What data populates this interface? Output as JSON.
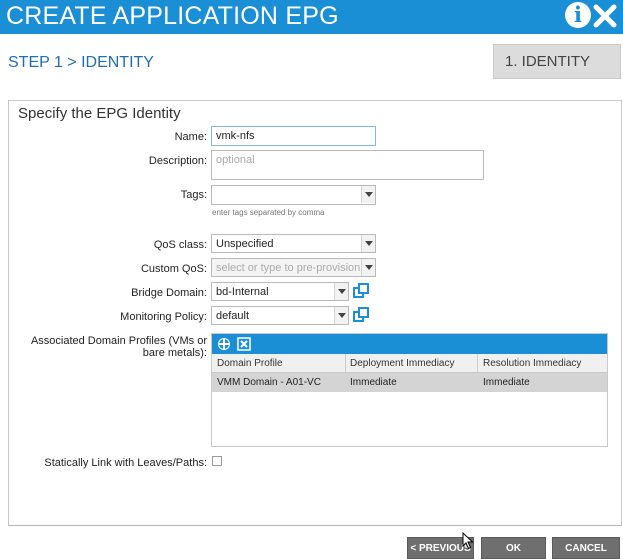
{
  "window": {
    "title": "CREATE APPLICATION EPG",
    "info_icon": "info-icon",
    "close_icon": "close-icon",
    "accent": "#1b8fd6"
  },
  "step": {
    "header": "STEP 1 > IDENTITY",
    "badge": "1. IDENTITY"
  },
  "form": {
    "section_title": "Specify the EPG Identity",
    "name": {
      "label": "Name:",
      "value": "vmk-nfs"
    },
    "description": {
      "label": "Description:",
      "placeholder": "optional"
    },
    "tags": {
      "label": "Tags:",
      "hint": "enter tags separated by comma"
    },
    "qos_class": {
      "label": "QoS class:",
      "value": "Unspecified"
    },
    "custom_qos": {
      "label": "Custom QoS:",
      "placeholder": "select or type to pre-provision"
    },
    "bridge_domain": {
      "label": "Bridge Domain:",
      "value": "bd-Internal"
    },
    "monitoring_policy": {
      "label": "Monitoring Policy:",
      "value": "default"
    },
    "domain_profiles": {
      "label_line1": "Associated Domain Profiles (VMs or",
      "label_line2": "bare metals):",
      "columns": [
        "Domain Profile",
        "Deployment Immediacy",
        "Resolution Immediacy"
      ],
      "rows": [
        [
          "VMM Domain - A01-VC",
          "Immediate",
          "Immediate"
        ]
      ]
    },
    "static_link": {
      "label": "Statically Link with Leaves/Paths:",
      "checked": false
    }
  },
  "footer": {
    "previous": "< PREVIOUS",
    "ok": "OK",
    "cancel": "CANCEL"
  }
}
